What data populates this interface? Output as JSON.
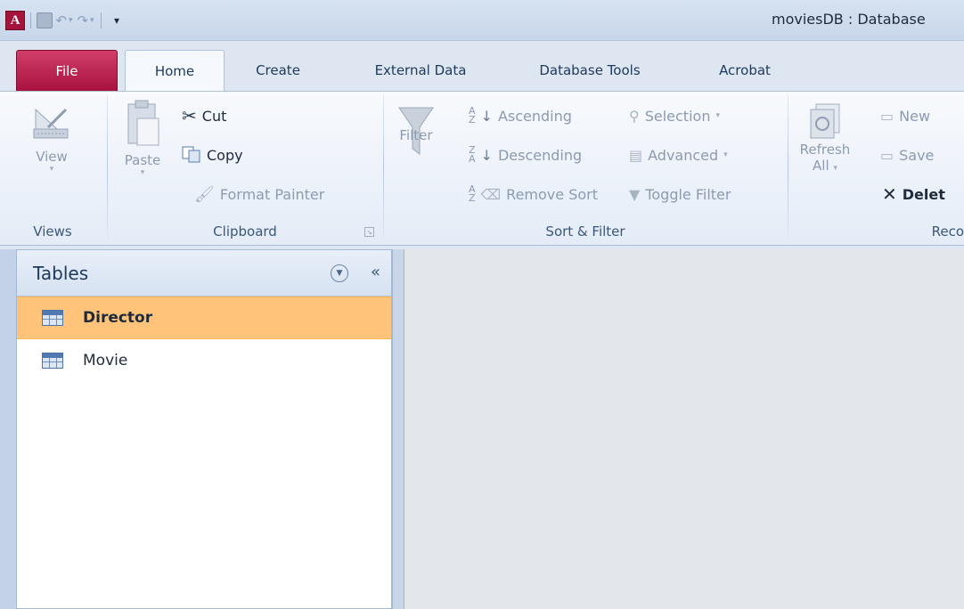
{
  "titlebar": {
    "app_logo": "A",
    "window_title": "moviesDB : Database"
  },
  "tabs": {
    "file": "File",
    "home": "Home",
    "create": "Create",
    "external_data": "External Data",
    "database_tools": "Database Tools",
    "acrobat": "Acrobat"
  },
  "ribbon": {
    "views": {
      "group_label": "Views",
      "view": "View"
    },
    "clipboard": {
      "group_label": "Clipboard",
      "paste": "Paste",
      "cut": "Cut",
      "copy": "Copy",
      "format_painter": "Format Painter"
    },
    "sort_filter": {
      "group_label": "Sort & Filter",
      "filter": "Filter",
      "ascending": "Ascending",
      "descending": "Descending",
      "remove_sort": "Remove Sort",
      "selection": "Selection",
      "advanced": "Advanced",
      "toggle_filter": "Toggle Filter"
    },
    "records": {
      "group_label": "Reco",
      "refresh_line1": "Refresh",
      "refresh_line2": "All",
      "new": "New",
      "save": "Save",
      "delete": "Delet"
    }
  },
  "nav_pane": {
    "title": "Tables",
    "items": [
      {
        "label": "Director",
        "selected": true
      },
      {
        "label": "Movie",
        "selected": false
      }
    ]
  },
  "colors": {
    "file_tab": "#a7133e",
    "selected_item": "#ffc47a",
    "ribbon_bg": "#e4ecf7"
  }
}
